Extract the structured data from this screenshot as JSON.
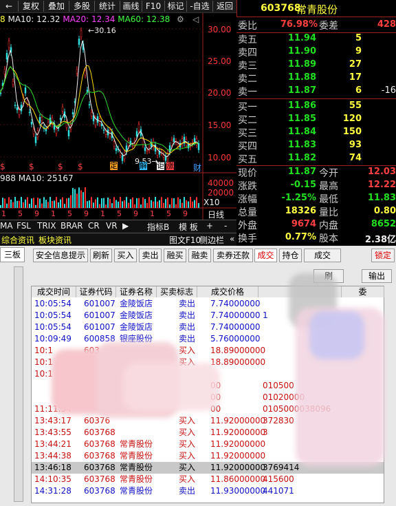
{
  "menu": [
    "复权",
    "叠加",
    "多股",
    "统计",
    "画线",
    "F10",
    "标记",
    "-自选",
    "返回"
  ],
  "menu_prefix": "←",
  "chart": {
    "ma_line": {
      "prefix": "8",
      "ma10": "MA10: 12.32",
      "ma20": "MA20: 12.34",
      "ma60": "MA60: 12.38"
    },
    "max_label": "30.16",
    "min_label": "9.53",
    "y_ticks": [
      "30.00",
      "25.00",
      "20.00",
      "15.00",
      "10.00"
    ],
    "event_marks": [
      "$",
      "$",
      "$",
      "$",
      "$",
      "定",
      "解",
      "讵",
      "涨",
      "财"
    ],
    "vol_line": {
      "prefix": "988",
      "ma10": "MA10: 25167"
    },
    "vol_ticks": [
      "40000",
      "20000",
      "X10"
    ],
    "x_ticks": [
      "1",
      "5",
      "9",
      "1",
      "5",
      "9",
      "1",
      "5",
      "9",
      "1",
      "5",
      "9"
    ],
    "period_tabs": [
      "日线",
      "+",
      "-"
    ],
    "indicator_tabs": [
      "MA",
      "FSL",
      "TRIX",
      "BRAR",
      "CR",
      "VR"
    ],
    "indicator_right": [
      "指标B",
      "模 板"
    ],
    "bottom_tabs": [
      "综合资讯",
      "板块资讯"
    ],
    "bottom_right": [
      "图文F10",
      "侧边栏",
      "«"
    ]
  },
  "quote": {
    "code": "603768",
    "name": "常青股份",
    "weibi_label": "委比",
    "weibi_val": "76.98%",
    "weicha_label": "委差",
    "weicha_val": "428",
    "sell": [
      {
        "label": "卖五",
        "price": "11.94",
        "vol": "5",
        "extra": ""
      },
      {
        "label": "卖四",
        "price": "11.90",
        "vol": "9",
        "extra": ""
      },
      {
        "label": "卖三",
        "price": "11.89",
        "vol": "27",
        "extra": ""
      },
      {
        "label": "卖二",
        "price": "11.88",
        "vol": "17",
        "extra": ""
      },
      {
        "label": "卖一",
        "price": "11.87",
        "vol": "6",
        "extra": "-16"
      }
    ],
    "buy": [
      {
        "label": "买一",
        "price": "11.86",
        "vol": "55"
      },
      {
        "label": "买二",
        "price": "11.85",
        "vol": "120"
      },
      {
        "label": "买三",
        "price": "11.84",
        "vol": "150"
      },
      {
        "label": "买四",
        "price": "11.83",
        "vol": "93"
      },
      {
        "label": "买五",
        "price": "11.82",
        "vol": "74"
      }
    ],
    "stats": [
      {
        "l1": "现价",
        "v1": "11.87",
        "l2": "今开",
        "v2": "12.03"
      },
      {
        "l1": "涨跌",
        "v1": "-0.15",
        "l2": "最高",
        "v2": "12.22"
      },
      {
        "l1": "涨幅",
        "v1": "-1.25%",
        "l2": "最低",
        "v2": "11.83"
      },
      {
        "l1": "总量",
        "v1": "18326",
        "l2": "量比",
        "v2": "0.80"
      },
      {
        "l1": "外盘",
        "v1": "9674",
        "l2": "内盘",
        "v2": "8652"
      },
      {
        "l1": "换手",
        "v1": "0.77%",
        "l2": "股本",
        "v2": "2.38亿"
      }
    ]
  },
  "trade": {
    "left_tab": "三板",
    "buttons": [
      "安全信息提示",
      "刷新",
      "买入",
      "卖出",
      "融买",
      "融卖",
      "卖券还款",
      "成交",
      "持仓",
      "",
      "成交",
      "锁定"
    ],
    "sub_buttons": [
      "刷",
      "输出"
    ],
    "headers": [
      "成交时间",
      "证券代码",
      "证券名称",
      "买卖标志",
      "成交价格",
      "",
      "委"
    ],
    "rows": [
      {
        "time": "10:05:54",
        "code": "601007",
        "name": "金陵饭店",
        "side": "卖出",
        "price": "7.74000000",
        "extra": "",
        "color": "blue"
      },
      {
        "time": "10:05:54",
        "code": "601007",
        "name": "金陵饭店",
        "side": "卖出",
        "price": "7.74000000",
        "extra": "1",
        "color": "blue"
      },
      {
        "time": "10:05:54",
        "code": "601007",
        "name": "金陵饭店",
        "side": "卖出",
        "price": "7.74000000",
        "extra": "",
        "color": "blue"
      },
      {
        "time": "10:09:49",
        "code": "600858",
        "name": "银座股份",
        "side": "卖出",
        "price": "5.76000000",
        "extra": "",
        "color": "blue"
      },
      {
        "time": "10:1",
        "code": "603",
        "name": "",
        "side": "买入",
        "price": "18.89000000",
        "extra": "",
        "color": "red"
      },
      {
        "time": "10:1",
        "code": "",
        "name": "",
        "side": "买入",
        "price": "18.89000000",
        "extra": "",
        "color": "red"
      },
      {
        "time": "10:1",
        "code": "",
        "name": "",
        "side": "",
        "price": "",
        "extra": "",
        "color": "red"
      },
      {
        "time": "",
        "code": "",
        "name": "",
        "side": "",
        "price": "00",
        "extra": "010500",
        "color": "red"
      },
      {
        "time": "",
        "code": "",
        "name": "",
        "side": "",
        "price": "00",
        "extra": "01020000",
        "color": "red"
      },
      {
        "time": "11:11:54",
        "code": "",
        "name": "",
        "side": "",
        "price": "00",
        "extra": "0105000038096",
        "color": "red"
      },
      {
        "time": "13:43:17",
        "code": "60376",
        "name": "",
        "side": "买入",
        "price": "11.92000000",
        "extra": "372830",
        "color": "red"
      },
      {
        "time": "13:43:55",
        "code": "603768",
        "name": "",
        "side": "买入",
        "price": "11.92000000",
        "extra": "3",
        "color": "red"
      },
      {
        "time": "13:44:21",
        "code": "603768",
        "name": "常青股份",
        "side": "买入",
        "price": "11.92000000",
        "extra": "",
        "color": "red"
      },
      {
        "time": "13:44:38",
        "code": "603768",
        "name": "常青股份",
        "side": "买入",
        "price": "11.92000000",
        "extra": "",
        "color": "red"
      },
      {
        "time": "13:46:18",
        "code": "603768",
        "name": "常青股份",
        "side": "买入",
        "price": "11.92000000",
        "extra": "3769414",
        "color": "sel"
      },
      {
        "time": "14:10:35",
        "code": "603768",
        "name": "常青股份",
        "side": "买入",
        "price": "11.86000000",
        "extra": "415600",
        "color": "red"
      },
      {
        "time": "14:31:28",
        "code": "603768",
        "name": "常青股份",
        "side": "卖出",
        "price": "11.93000000",
        "extra": "441071",
        "color": "blue"
      }
    ]
  }
}
